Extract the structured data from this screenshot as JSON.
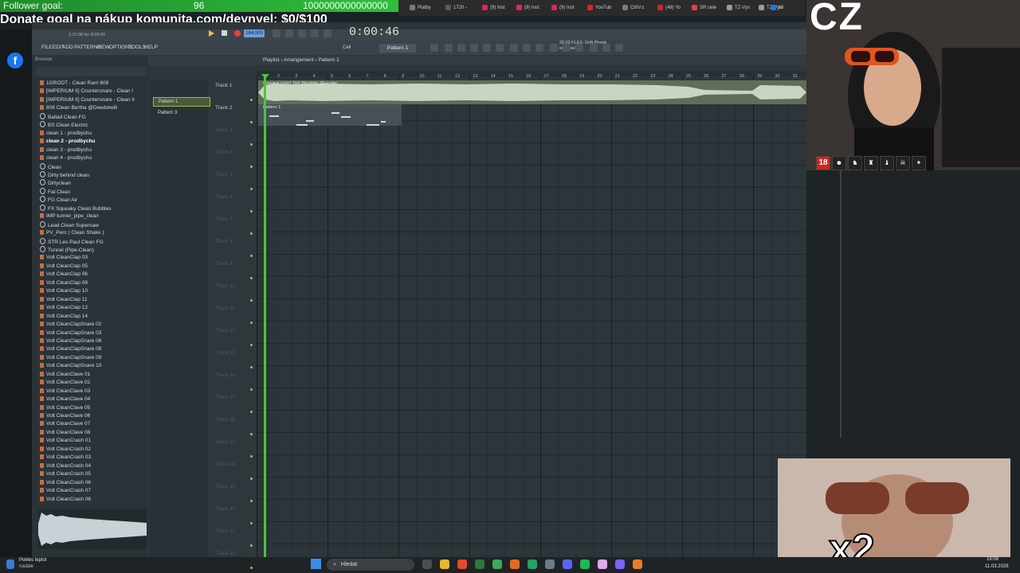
{
  "overlay": {
    "follower_goal_label": "Follower goal:",
    "follower_count": "96",
    "follower_target": "1000000000000000",
    "donate_text": "Donate goal na nákup komunita.com/deynyel: $0/$100"
  },
  "browser_tabs": [
    {
      "label": "Platby",
      "color": "#7a7a7a"
    },
    {
      "label": "1720 -",
      "color": "#5a5a5a"
    },
    {
      "label": "(9) Inst",
      "color": "#d6286b"
    },
    {
      "label": "(9) Inst",
      "color": "#d6286b"
    },
    {
      "label": "(9) Inst",
      "color": "#d6286b"
    },
    {
      "label": "YouTub",
      "color": "#e02020"
    },
    {
      "label": "CtrlV.c",
      "color": "#7a7a7a"
    },
    {
      "label": "(48) Yo",
      "color": "#e02020"
    },
    {
      "label": "SR cele",
      "color": "#e04040"
    },
    {
      "label": "TZ-Vys",
      "color": "#9a9a9a"
    },
    {
      "label": "TZ-Vys",
      "color": "#9a9a9a"
    },
    {
      "label": "Mi",
      "color": "#1877f2"
    }
  ],
  "fl": {
    "menu": [
      "FILE",
      "EDIT",
      "ADD",
      "PATTERNS",
      "VIEW",
      "OPTIONS",
      "TOOLS",
      "HELP"
    ],
    "time": "0:00:46",
    "tempo": "164.000",
    "pattern": "Pattern 1",
    "snap": "Cell",
    "hint_line1": "26:02 FLEX: Drift Phonk",
    "hint_line2": "out now!",
    "position": "1:01:00 for 8:00:00",
    "browser_label": "Browser",
    "breadcrumb": "Playlist › Arrangement › Pattern 1"
  },
  "browser_items": [
    {
      "label": "1GRODT - Clean Rarri 808",
      "icon": "file"
    },
    {
      "label": "[IMPERIUM II] Countersnare - Clean I",
      "icon": "file"
    },
    {
      "label": "[IMPERIUM II] Countersnare - Clean II",
      "icon": "file"
    },
    {
      "label": "808 Clean Bertha @Deedotwill",
      "icon": "file"
    },
    {
      "label": "Ballad Clean FG",
      "icon": "star"
    },
    {
      "label": "BS Clean Electric",
      "icon": "star"
    },
    {
      "label": "clean 1 - prodbychu",
      "icon": "file"
    },
    {
      "label": "clean 2 - prodbychu",
      "icon": "file"
    },
    {
      "label": "clean 3 - prodbychu",
      "icon": "file"
    },
    {
      "label": "clean 4 - prodbychu",
      "icon": "file"
    },
    {
      "label": "Clean",
      "icon": "star"
    },
    {
      "label": "Dirty behind clean",
      "icon": "star"
    },
    {
      "label": "Dirtyclean",
      "icon": "star"
    },
    {
      "label": "Fat Clean",
      "icon": "star"
    },
    {
      "label": "FG Clean Air",
      "icon": "star"
    },
    {
      "label": "FX Squeaky Clean Bubbles",
      "icon": "star"
    },
    {
      "label": "IMP tunnel_pipe_clean",
      "icon": "file"
    },
    {
      "label": "Lead Clean Supersaw",
      "icon": "star"
    },
    {
      "label": "PV_Perc ( Clean Shake )",
      "icon": "file"
    },
    {
      "label": "STR Les Paul Clean FG",
      "icon": "star"
    },
    {
      "label": "Tunnel (Pipe-Clean)",
      "icon": "star"
    },
    {
      "label": "Volt CleanClap 03",
      "icon": "file"
    },
    {
      "label": "Volt CleanClap 05",
      "icon": "file"
    },
    {
      "label": "Volt CleanClap 06",
      "icon": "file"
    },
    {
      "label": "Volt CleanClap 09",
      "icon": "file"
    },
    {
      "label": "Volt CleanClap 10",
      "icon": "file"
    },
    {
      "label": "Volt CleanClap 11",
      "icon": "file"
    },
    {
      "label": "Volt CleanClap 12",
      "icon": "file"
    },
    {
      "label": "Volt CleanClap 14",
      "icon": "file"
    },
    {
      "label": "Volt CleanClapSnare 02",
      "icon": "file"
    },
    {
      "label": "Volt CleanClapSnare 03",
      "icon": "file"
    },
    {
      "label": "Volt CleanClapSnare 06",
      "icon": "file"
    },
    {
      "label": "Volt CleanClapSnare 08",
      "icon": "file"
    },
    {
      "label": "Volt CleanClapSnare 09",
      "icon": "file"
    },
    {
      "label": "Volt CleanClapSnare 10",
      "icon": "file"
    },
    {
      "label": "Volt CleanClave 01",
      "icon": "file"
    },
    {
      "label": "Volt CleanClave 02",
      "icon": "file"
    },
    {
      "label": "Volt CleanClave 03",
      "icon": "file"
    },
    {
      "label": "Volt CleanClave 04",
      "icon": "file"
    },
    {
      "label": "Volt CleanClave 05",
      "icon": "file"
    },
    {
      "label": "Volt CleanClave 06",
      "icon": "file"
    },
    {
      "label": "Volt CleanClave 07",
      "icon": "file"
    },
    {
      "label": "Volt CleanClave 08",
      "icon": "file"
    },
    {
      "label": "Volt CleanCrash 01",
      "icon": "file"
    },
    {
      "label": "Volt CleanCrash 02",
      "icon": "file"
    },
    {
      "label": "Volt CleanCrash 03",
      "icon": "file"
    },
    {
      "label": "Volt CleanCrash 04",
      "icon": "file"
    },
    {
      "label": "Volt CleanCrash 05",
      "icon": "file"
    },
    {
      "label": "Volt CleanCrash 06",
      "icon": "file"
    },
    {
      "label": "Volt CleanCrash 07",
      "icon": "file"
    },
    {
      "label": "Volt CleanCrash 08",
      "icon": "file"
    }
  ],
  "patterns": [
    "Pattern 1",
    "Pattern 3"
  ],
  "tracks": [
    "Track 1",
    "Track 2",
    "Track 3",
    "Track 4",
    "Track 5",
    "Track 6",
    "Track 7",
    "Track 8",
    "Track 9",
    "Track 10",
    "Track 11",
    "Track 12",
    "Track 13",
    "Track 14",
    "Track 15",
    "Track 16",
    "Track 17",
    "Track 18",
    "Track 19",
    "Track 20",
    "Track 21",
    "Track 22"
  ],
  "ruler": [
    "2",
    "3",
    "4",
    "5",
    "6",
    "7",
    "8",
    "9",
    "10",
    "11",
    "12",
    "13",
    "14",
    "15",
    "16",
    "17",
    "18",
    "19",
    "20",
    "21",
    "22",
    "23",
    "24",
    "25",
    "26",
    "27",
    "28",
    "29",
    "30",
    "31"
  ],
  "audio_clip_label": "vocemal (sylo) 164 @bobbtz @exciter",
  "pattern_clip_label": "Pattern 1",
  "webcam": {
    "overlay_text": "CZ",
    "badge": "18"
  },
  "meme": {
    "text": "x2"
  },
  "taskbar": {
    "weather_temp": "Pokles teplot",
    "weather_desc": "nadále",
    "search_placeholder": "Hledat",
    "time": "18:08",
    "date": "11.03.2026"
  }
}
